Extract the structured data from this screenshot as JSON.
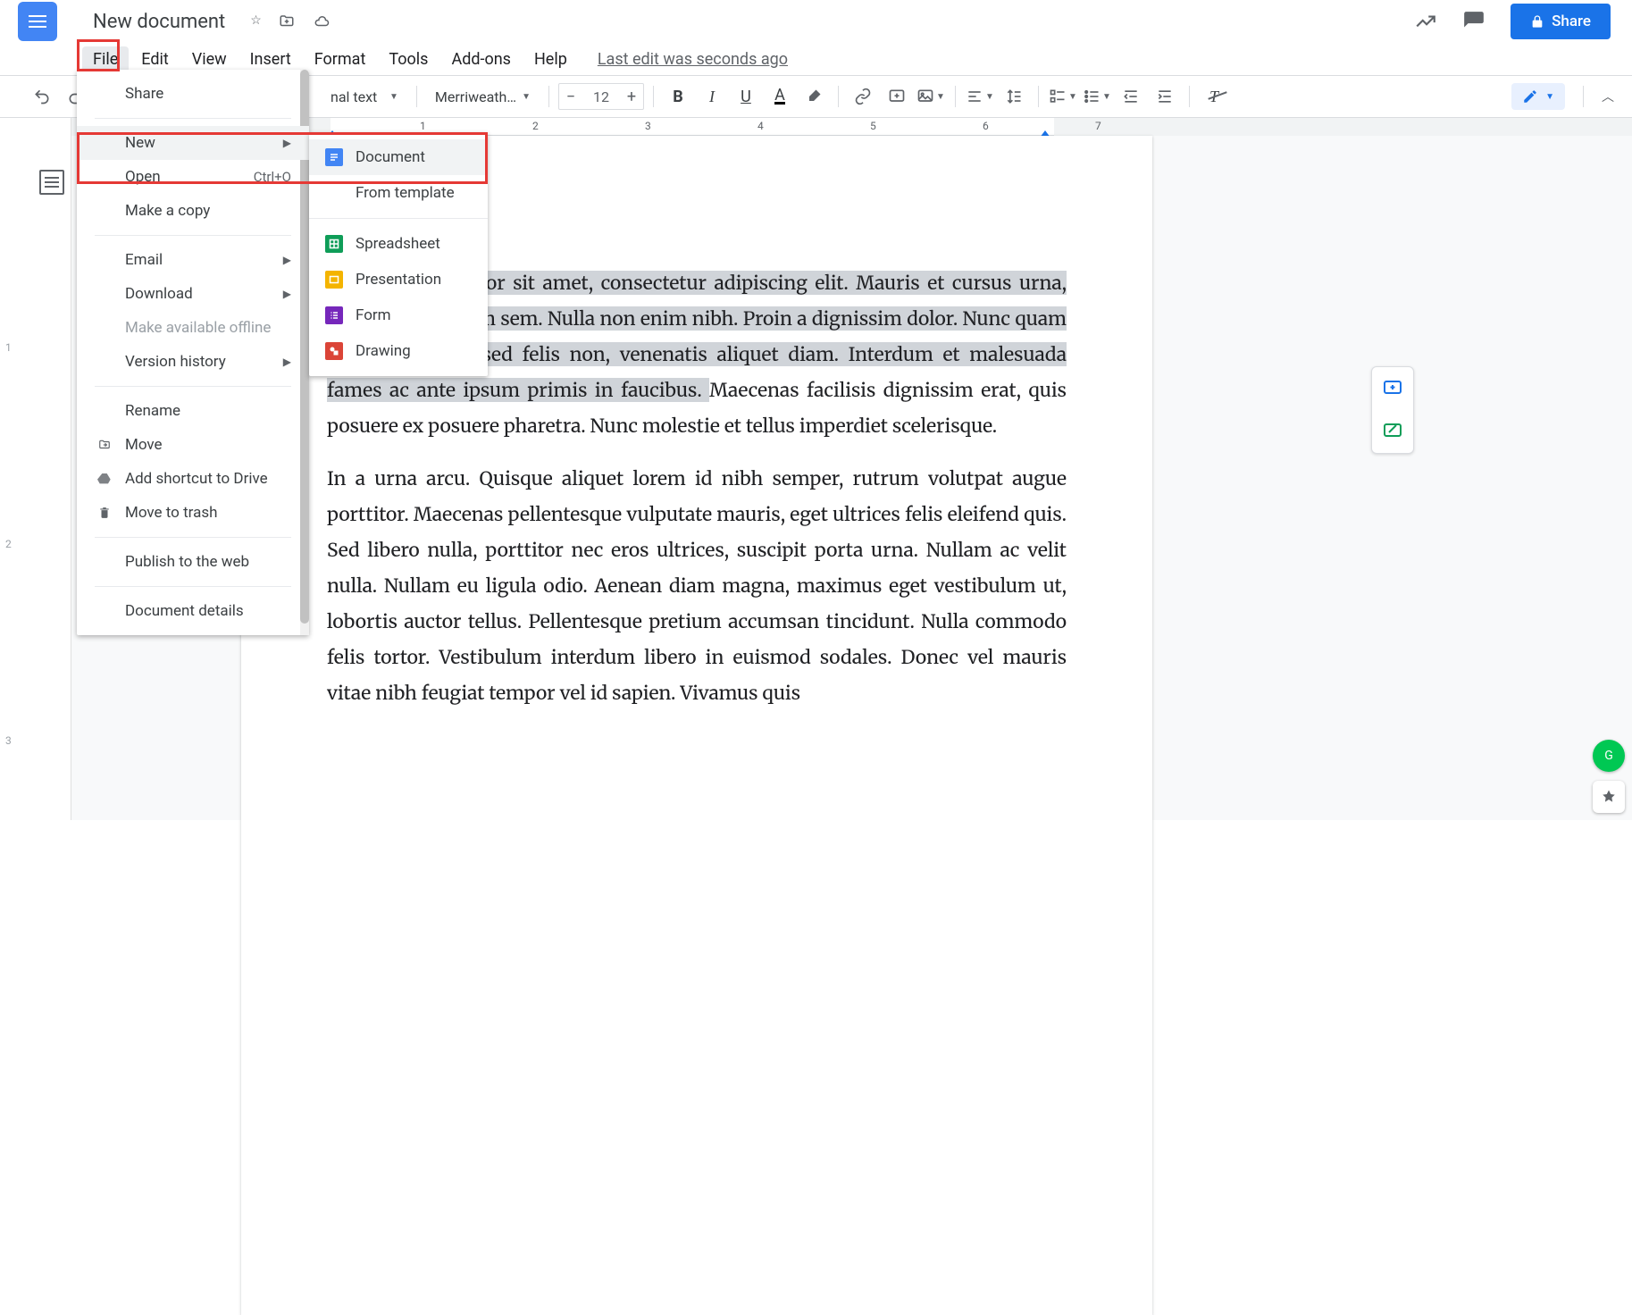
{
  "doc": {
    "title": "New document"
  },
  "menubar": {
    "items": [
      "File",
      "Edit",
      "View",
      "Insert",
      "Format",
      "Tools",
      "Add-ons",
      "Help"
    ],
    "last_edit": "Last edit was seconds ago"
  },
  "toolbar": {
    "style_dd": "Normal text",
    "font_dd": "Merriweath…",
    "font_size": "12"
  },
  "share": {
    "label": "Share"
  },
  "file_menu": {
    "share": "Share",
    "new": "New",
    "open": "Open",
    "open_shortcut": "Ctrl+O",
    "make_copy": "Make a copy",
    "email": "Email",
    "download": "Download",
    "offline": "Make available offline",
    "version": "Version history",
    "rename": "Rename",
    "move": "Move",
    "add_shortcut": "Add shortcut to Drive",
    "trash": "Move to trash",
    "publish": "Publish to the web",
    "details": "Document details"
  },
  "submenu": {
    "document": "Document",
    "from_template": "From template",
    "spreadsheet": "Spreadsheet",
    "presentation": "Presentation",
    "form": "Form",
    "drawing": "Drawing"
  },
  "ruler": {
    "nums": [
      "1",
      "2",
      "3",
      "4",
      "5",
      "6",
      "7"
    ]
  },
  "vruler": {
    "nums": [
      "1",
      "2",
      "3"
    ]
  },
  "body": {
    "p1_sel": "Lorem ipsum dolor sit amet, consectetur adipiscing elit. Mauris et cursus urna, non condimentum sem. Nulla non enim nibh. Proin a dignissim dolor. Nunc quam velit, consequat sed felis non, venenatis aliquet diam. Interdum et malesuada fames ac ante ipsum primis in faucibus. ",
    "p1_rest": "Maecenas facilisis dignissim erat, quis posuere ex posuere pharetra. Nunc molestie et tellus imperdiet scelerisque.",
    "p2": "In a urna arcu. Quisque aliquet lorem id nibh semper, rutrum volutpat augue porttitor. Maecenas pellentesque vulputate mauris, eget ultrices felis eleifend quis. Sed libero nulla, porttitor nec eros ultrices, suscipit porta urna. Nullam ac velit nulla. Nullam eu ligula odio. Aenean diam magna, maximus eget vestibulum ut, lobortis auctor tellus. Pellentesque pretium accumsan tincidunt. Nulla commodo felis tortor. Vestibulum interdum libero in euismod sodales. Donec vel mauris vitae nibh feugiat tempor vel id sapien. Vivamus quis"
  }
}
